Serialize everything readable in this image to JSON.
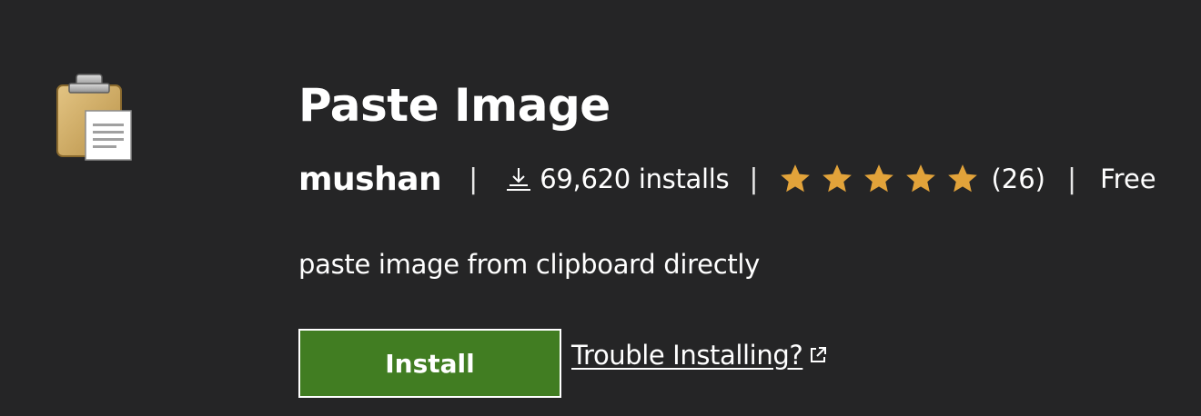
{
  "extension": {
    "icon": "clipboard-icon",
    "title": "Paste Image",
    "publisher": "mushan",
    "separator": "|",
    "installs_text": "69,620 installs",
    "rating": {
      "stars": 5,
      "max_stars": 5,
      "count_text": "(26)"
    },
    "price": "Free",
    "description": "paste image from clipboard directly"
  },
  "actions": {
    "install_label": "Install",
    "trouble_label": "Trouble Installing?"
  },
  "colors": {
    "background": "#252526",
    "install_button": "#417d22",
    "star": "#e2a33a",
    "text": "#ffffff"
  }
}
